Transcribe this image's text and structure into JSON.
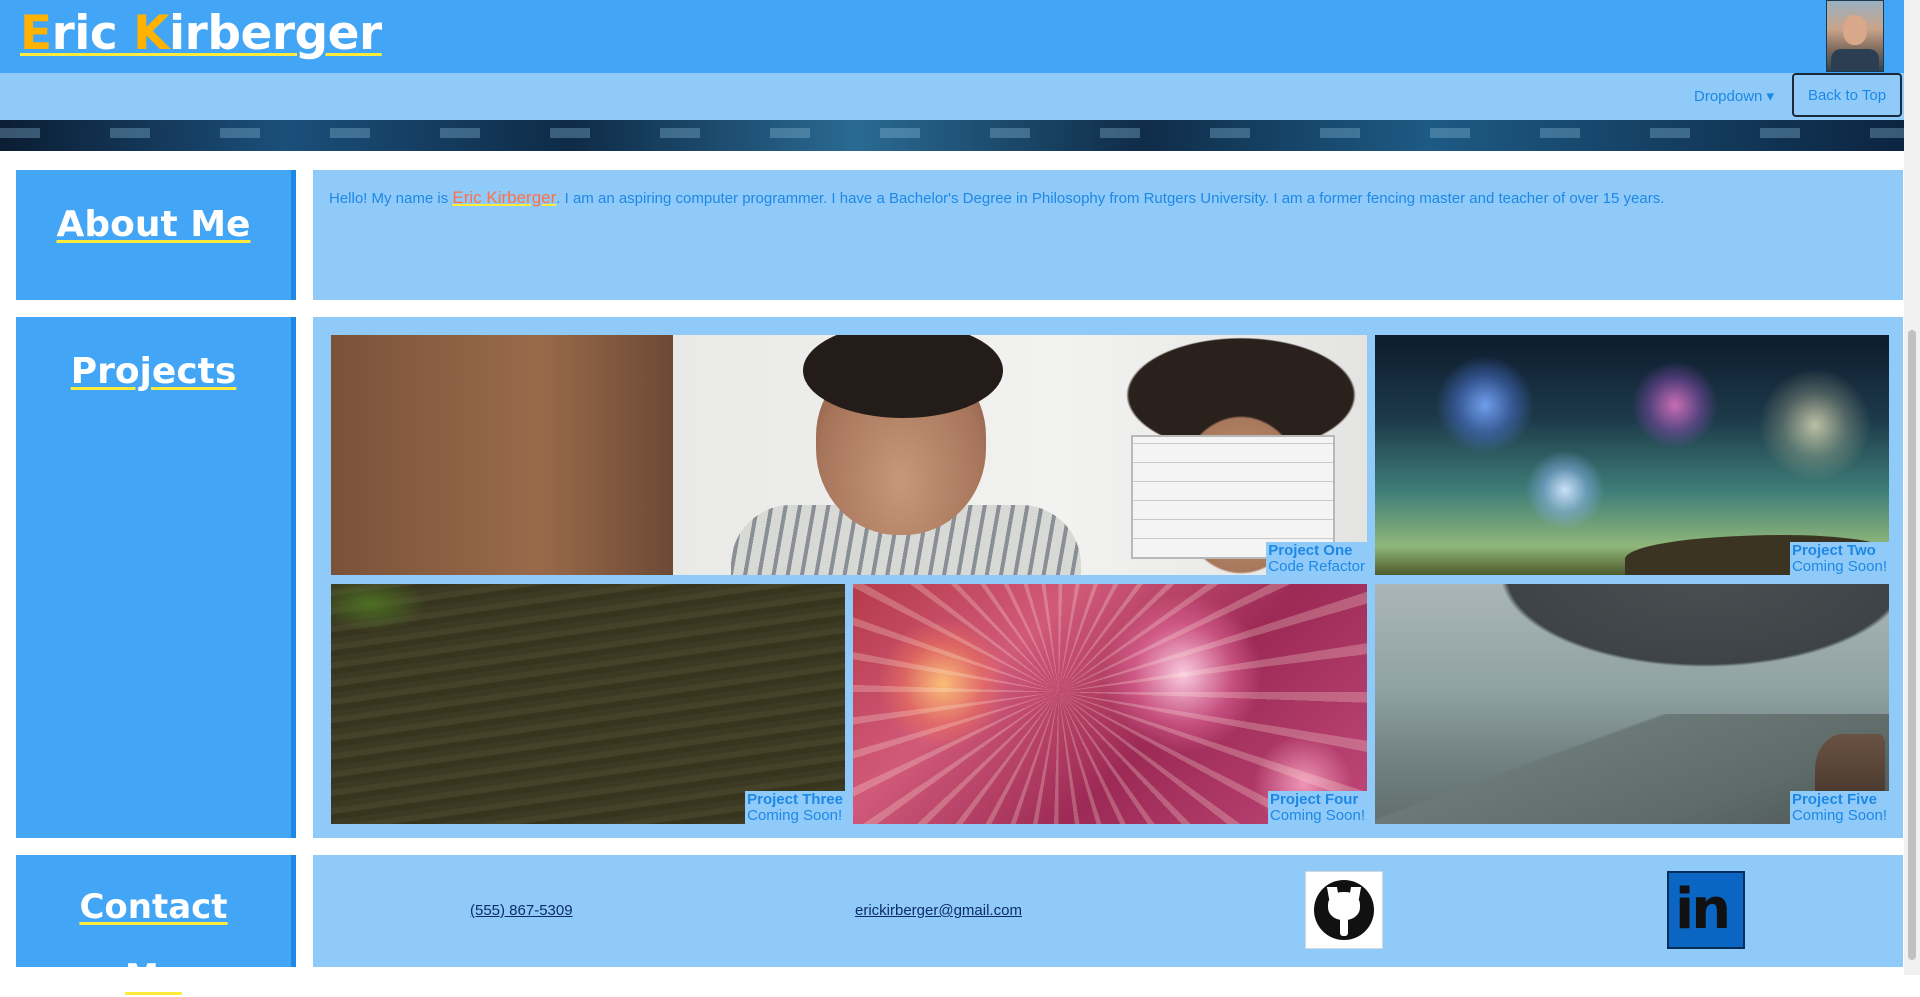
{
  "header": {
    "brand_first_initial": "E",
    "brand_first_rest": "ric ",
    "brand_last_initial": "K",
    "brand_last_rest": "irberger"
  },
  "nav": {
    "dropdown_label": "Dropdown",
    "back_to_top_label": "Back to Top"
  },
  "about": {
    "title": "About Me",
    "text_before": "Hello! My name is ",
    "name": "Eric Kirberger",
    "text_after": ". I am an aspiring computer programmer. I have a Bachelor's Degree in Philosophy from Rutgers University. I am a former fencing master and teacher of over 15 years."
  },
  "projects": {
    "title": "Projects",
    "items": [
      {
        "title": "Project One",
        "subtitle": "Code Refactor"
      },
      {
        "title": "Project Two",
        "subtitle": "Coming Soon!"
      },
      {
        "title": "Project Three",
        "subtitle": "Coming Soon!"
      },
      {
        "title": "Project Four",
        "subtitle": "Coming Soon!"
      },
      {
        "title": "Project Five",
        "subtitle": "Coming Soon!"
      }
    ]
  },
  "contact": {
    "title_line1": "Contact",
    "title_line2": "Me",
    "phone": "(555) 867-5309",
    "email": "erickirberger@gmail.com",
    "github_icon": "github-icon",
    "linkedin_icon": "linkedin-icon",
    "linkedin_text": "in"
  },
  "colors": {
    "header_bg": "#42a5f5",
    "nav_bg": "#90caf9",
    "accent_text": "#1e88e5",
    "underline": "#ffeb3b",
    "name_highlight": "#ff7043"
  }
}
